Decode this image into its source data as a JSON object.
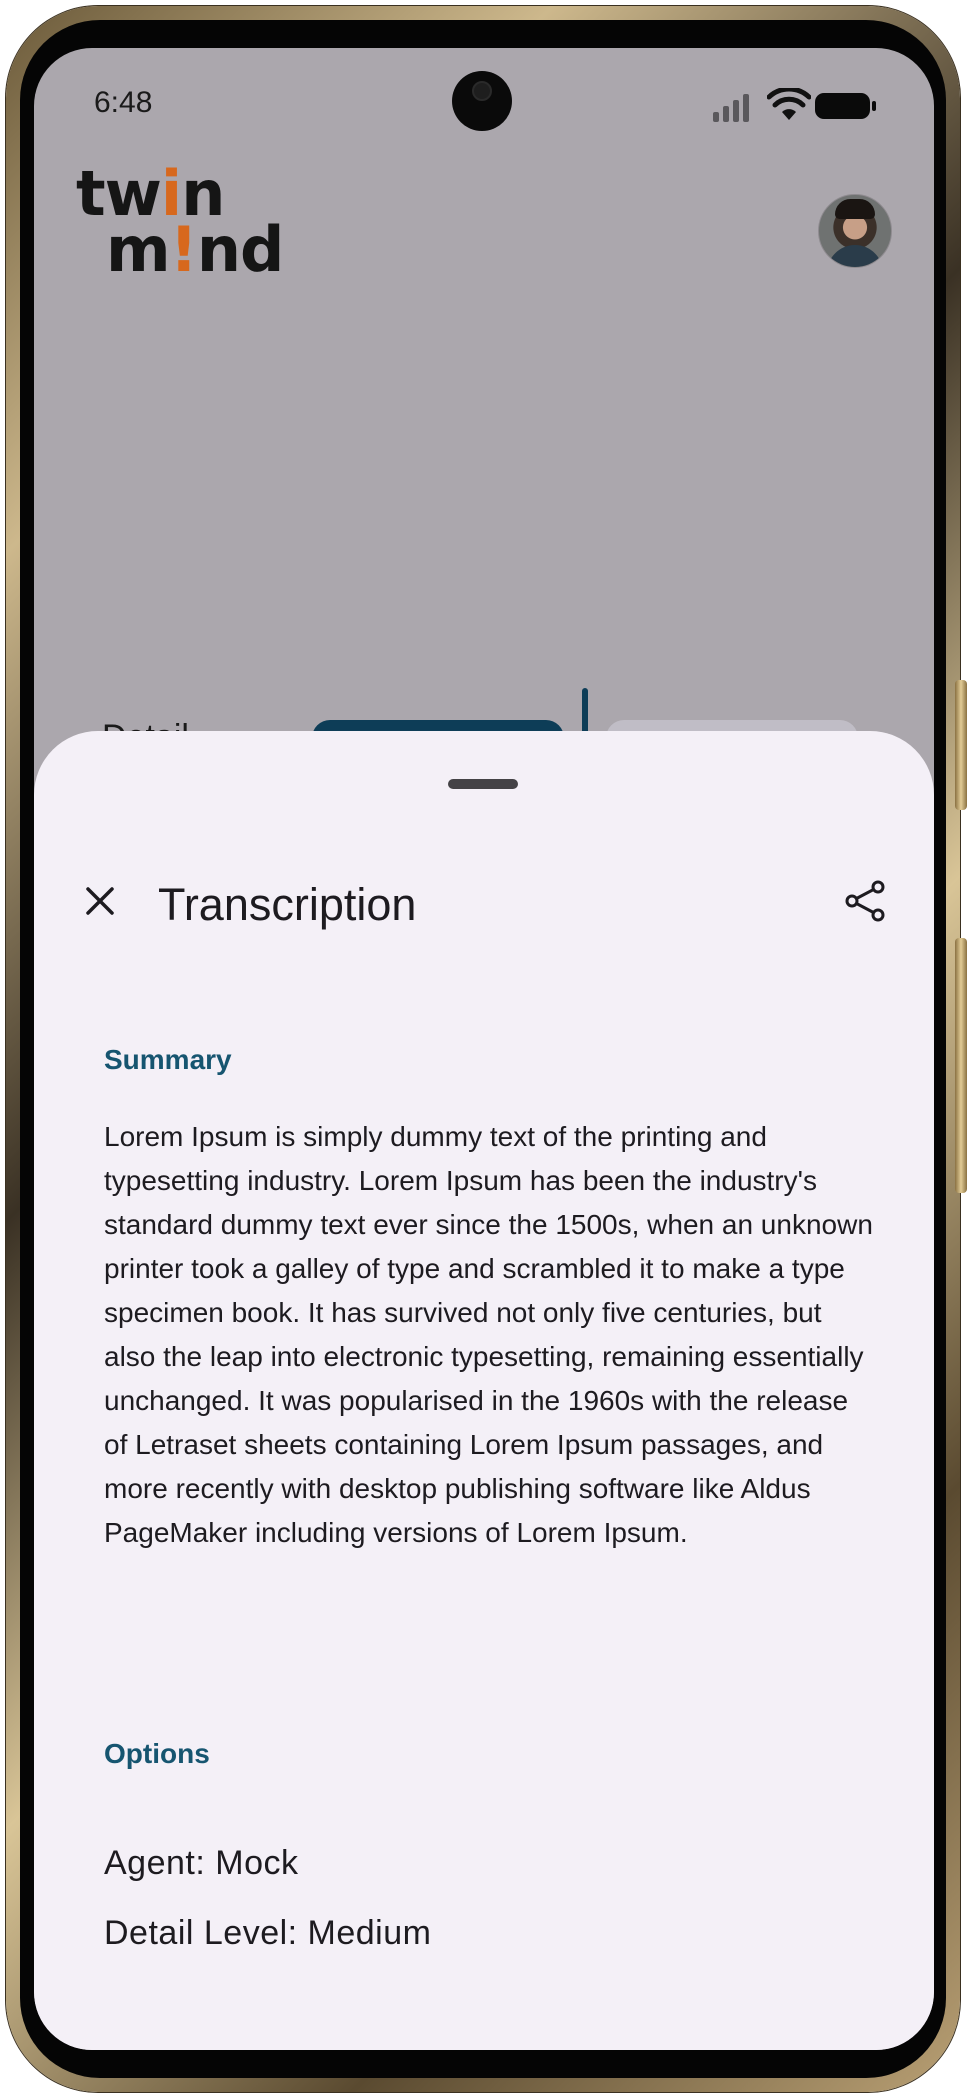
{
  "status_bar": {
    "time": "6:48",
    "icons": [
      "cellular-signal-icon",
      "wifi-icon",
      "battery-icon"
    ]
  },
  "header": {
    "logo_text": [
      "twin",
      "mind"
    ],
    "avatar": "user-avatar"
  },
  "background_view": {
    "partial_label": "Detail"
  },
  "sheet": {
    "title": "Transcription",
    "icons": [
      "close-icon",
      "share-icon"
    ],
    "summary": {
      "heading": "Summary",
      "text": "Lorem Ipsum is simply dummy text of the printing and typesetting industry. Lorem Ipsum has been the industry's standard dummy text ever since the 1500s, when an unknown printer took a galley of type and scrambled it to make a type specimen book. It has survived not only five centuries, but also the leap into electronic typesetting, remaining essentially unchanged. It was popularised in the 1960s with the release of Letraset sheets containing Lorem Ipsum passages, and more recently with desktop publishing software like Aldus PageMaker including versions of Lorem Ipsum."
    },
    "options": {
      "heading": "Options",
      "agent": "Agent: Mock",
      "detail_level": "Detail Level: Medium"
    }
  },
  "colors": {
    "accent": "#165570",
    "scrim": "#aba7ad",
    "sheet_bg": "#f4f0f7",
    "logo_accent": "#d7681d"
  }
}
